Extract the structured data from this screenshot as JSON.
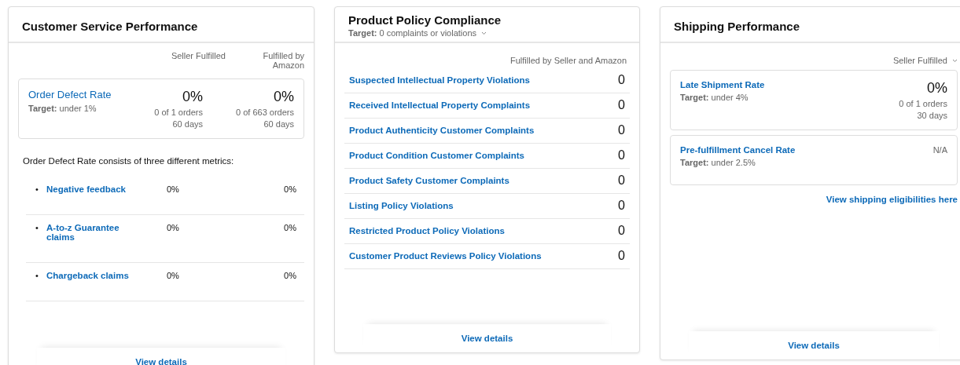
{
  "customer_service": {
    "title": "Customer Service Performance",
    "columns": [
      "Seller Fulfilled",
      "Fulfilled by Amazon"
    ],
    "order_defect_rate": {
      "name": "Order Defect Rate",
      "target": "**Target:** under 1%",
      "seller": {
        "value": "0%",
        "orders": "0 of 1 orders",
        "period": "60 days"
      },
      "amazon": {
        "value": "0%",
        "orders": "0 of 663 orders",
        "period": "60 days"
      }
    },
    "note": "Order Defect Rate consists of three different metrics:",
    "metrics": [
      {
        "bullet": "•",
        "name": "Negative feedback",
        "seller": "0%",
        "amazon": "0%"
      },
      {
        "bullet": "•",
        "name": "A-to-z Guarantee claims",
        "seller": "0%",
        "amazon": "0%"
      },
      {
        "bullet": "•",
        "name": "Chargeback claims",
        "seller": "0%",
        "amazon": "0%"
      }
    ],
    "footer_link": "View details"
  },
  "product_policy": {
    "title": "Product Policy Compliance",
    "target": "**Target:** 0 complaints or violations",
    "column": "Fulfilled by Seller and Amazon",
    "rows": [
      {
        "name": "Suspected Intellectual Property Violations",
        "count": "0"
      },
      {
        "name": "Received Intellectual Property Complaints",
        "count": "0"
      },
      {
        "name": "Product Authenticity Customer Complaints",
        "count": "0"
      },
      {
        "name": "Product Condition Customer Complaints",
        "count": "0"
      },
      {
        "name": "Product Safety Customer Complaints",
        "count": "0"
      },
      {
        "name": "Listing Policy Violations",
        "count": "0"
      },
      {
        "name": "Restricted Product Policy Violations",
        "count": "0"
      },
      {
        "name": "Customer Product Reviews Policy Violations",
        "count": "0"
      }
    ],
    "footer_link": "View details"
  },
  "shipping": {
    "title": "Shipping Performance",
    "filter": "Seller Fulfilled",
    "metrics": [
      {
        "kind": "value",
        "name": "Late Shipment Rate",
        "target": "**Target:** under 4%",
        "value": "0%",
        "orders": "0 of 1 orders",
        "period": "30 days"
      },
      {
        "kind": "na",
        "name": "Pre-fulfillment Cancel Rate",
        "target": "**Target:** under 2.5%",
        "value": "N/A"
      }
    ],
    "link": "View shipping eligibilities here",
    "footer_link": "View details"
  }
}
